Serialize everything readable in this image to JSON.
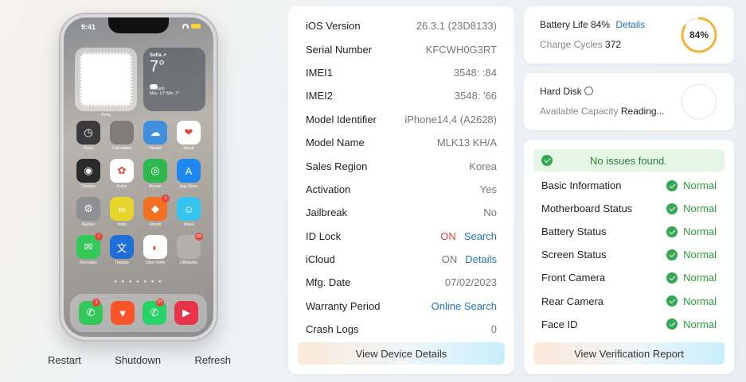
{
  "phone": {
    "time": "9:41",
    "clock_widget_label": "Reloj",
    "weather": {
      "city": "Sofia ➚",
      "temp": "7°",
      "condition": "Nublado",
      "range": "Máx. 13° Mín. 2°"
    },
    "apps": [
      {
        "label": "Reloj",
        "icon": "clock-icon",
        "color": "#3b3b3d",
        "glyph": "◷",
        "badge": ""
      },
      {
        "label": "Calendario",
        "icon": "calendar-icon",
        "color": "#7f7d79",
        "glyph": "",
        "badge": ""
      },
      {
        "label": "Tiempo",
        "icon": "weather-icon",
        "color": "#3f8fdc",
        "glyph": "☁",
        "badge": ""
      },
      {
        "label": "Salud",
        "icon": "health-icon",
        "color": "#ffffff",
        "glyph": "❤",
        "badge": ""
      },
      {
        "label": "Cámara",
        "icon": "camera-icon",
        "color": "#2a2a2c",
        "glyph": "◉",
        "badge": ""
      },
      {
        "label": "Fotos",
        "icon": "photos-icon",
        "color": "#ffffff",
        "glyph": "✿",
        "badge": ""
      },
      {
        "label": "Buscar",
        "icon": "find-my-icon",
        "color": "#2fb850",
        "glyph": "◎",
        "badge": ""
      },
      {
        "label": "App Store",
        "icon": "app-store-icon",
        "color": "#1e88f0",
        "glyph": "A",
        "badge": ""
      },
      {
        "label": "Ajustes",
        "icon": "settings-icon",
        "color": "#8e8e93",
        "glyph": "⚙",
        "badge": ""
      },
      {
        "label": "Yettel",
        "icon": "yettel-icon",
        "color": "#e6d52a",
        "glyph": "∞",
        "badge": ""
      },
      {
        "label": "Moovit",
        "icon": "moovit-icon",
        "color": "#f36f21",
        "glyph": "◆",
        "badge": "1"
      },
      {
        "label": "Waze",
        "icon": "waze-icon",
        "color": "#35c3ef",
        "glyph": "☺",
        "badge": ""
      },
      {
        "label": "Mensajes",
        "icon": "messages-icon",
        "color": "#34c759",
        "glyph": "✉",
        "badge": "1"
      },
      {
        "label": "Traducir",
        "icon": "translate-icon",
        "color": "#1f6fd6",
        "glyph": "文",
        "badge": ""
      },
      {
        "label": "Okta Verify",
        "icon": "okta-icon",
        "color": "#ffffff",
        "glyph": "◐",
        "badge": ""
      },
      {
        "label": "Utilidades",
        "icon": "utilities-folder-icon",
        "color": "#b3b0ab",
        "glyph": "",
        "badge": "59"
      }
    ],
    "dock": [
      {
        "icon": "phone-icon",
        "color": "#34c759",
        "glyph": "✆",
        "badge": "1"
      },
      {
        "icon": "brave-icon",
        "color": "#fb542b",
        "glyph": "▼",
        "badge": ""
      },
      {
        "icon": "whatsapp-icon",
        "color": "#25d366",
        "glyph": "✆",
        "badge": "27"
      },
      {
        "icon": "music-icon",
        "color": "#e8334a",
        "glyph": "▶",
        "badge": ""
      }
    ],
    "actions": {
      "restart": "Restart",
      "shutdown": "Shutdown",
      "refresh": "Refresh"
    }
  },
  "info": {
    "rows": [
      {
        "label": "iOS Version",
        "value": "26.3.1 (23D8133)"
      },
      {
        "label": "Serial Number",
        "value": "KFCWH0G3RT"
      },
      {
        "label": "IMEI1",
        "value": "3548:            :84"
      },
      {
        "label": "IMEI2",
        "value": "3548:            '66"
      },
      {
        "label": "Model Identifier",
        "value": "iPhone14,4 (A2628)"
      },
      {
        "label": "Model Name",
        "value": "MLK13 KH/A"
      },
      {
        "label": "Sales Region",
        "value": "Korea"
      },
      {
        "label": "Activation",
        "value": "Yes"
      },
      {
        "label": "Jailbreak",
        "value": "No"
      },
      {
        "label": "ID Lock",
        "value": "ON",
        "link": "Search"
      },
      {
        "label": "iCloud",
        "value": "ON",
        "link": "Details"
      },
      {
        "label": "Mfg. Date",
        "value": "07/02/2023"
      },
      {
        "label": "Warranty Period",
        "link": "Online Search"
      },
      {
        "label": "Crash Logs",
        "value": "0"
      }
    ],
    "button": "View Device Details"
  },
  "battery": {
    "label": "Battery Life 84%",
    "details_link": "Details",
    "cycles_label": "Charge Cycles",
    "cycles_value": "372",
    "percent_text": "84%",
    "level": 0.84,
    "ring_color": "#f2b53a"
  },
  "disk": {
    "label": "Hard Disk",
    "capacity_label": "Available Capacity",
    "capacity_value": "Reading..."
  },
  "check": {
    "banner": "No issues found.",
    "items": [
      {
        "label": "Basic Information",
        "status": "Normal"
      },
      {
        "label": "Motherboard Status",
        "status": "Normal"
      },
      {
        "label": "Battery Status",
        "status": "Normal"
      },
      {
        "label": "Screen Status",
        "status": "Normal"
      },
      {
        "label": "Front Camera",
        "status": "Normal"
      },
      {
        "label": "Rear Camera",
        "status": "Normal"
      },
      {
        "label": "Face ID",
        "status": "Normal"
      }
    ],
    "button": "View Verification Report"
  }
}
